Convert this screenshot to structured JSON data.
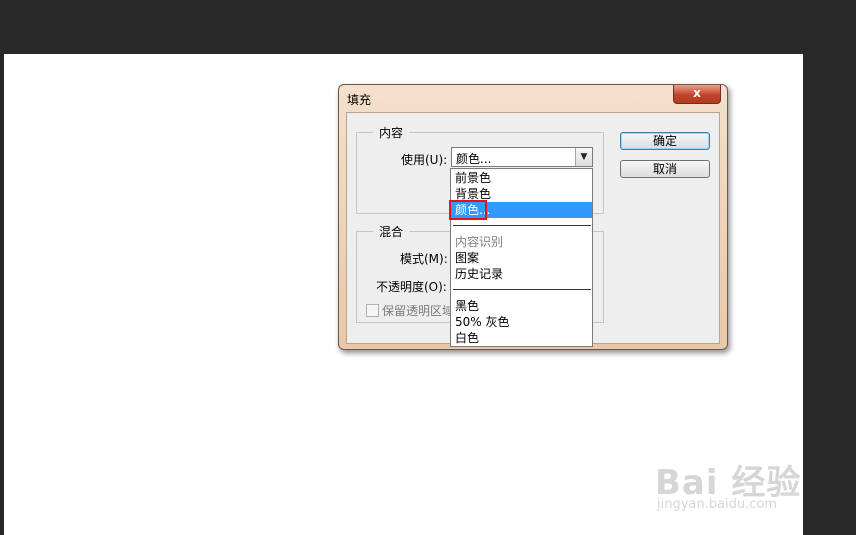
{
  "dialog": {
    "title": "填充",
    "close_label": "x",
    "content_group": {
      "legend": "内容",
      "use_label": "使用(U):",
      "use_value": "颜色..."
    },
    "blend_group": {
      "legend": "混合",
      "mode_label": "模式(M):",
      "opacity_label": "不透明度(O):",
      "preserve_label": "保留透明区域"
    },
    "ok_label": "确定",
    "cancel_label": "取消"
  },
  "dropdown": {
    "items": [
      {
        "label": "前景色",
        "state": "normal"
      },
      {
        "label": "背景色",
        "state": "normal"
      },
      {
        "label": "颜色...",
        "state": "selected"
      },
      {
        "label": "内容识别",
        "state": "disabled"
      },
      {
        "label": "图案",
        "state": "normal"
      },
      {
        "label": "历史记录",
        "state": "normal"
      },
      {
        "label": "黑色",
        "state": "normal"
      },
      {
        "label": "50% 灰色",
        "state": "normal"
      },
      {
        "label": "白色",
        "state": "normal"
      }
    ]
  },
  "watermark": {
    "logo_text": "Bai 经验",
    "url": "jingyan.baidu.com"
  },
  "colors": {
    "selection": "#3399ff",
    "highlight_box": "#e0141e",
    "workspace_bg": "#282828",
    "close_button": "#c0442c"
  }
}
